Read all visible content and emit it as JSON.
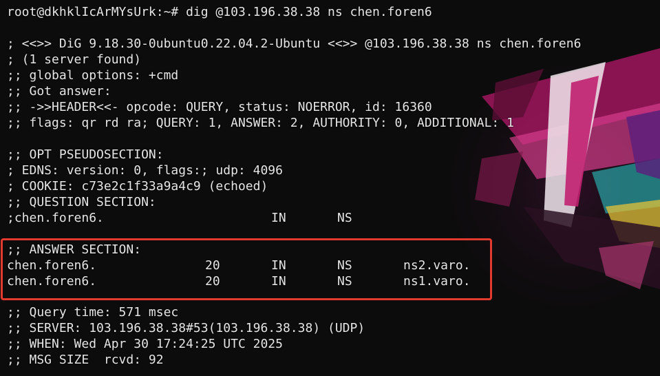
{
  "prompt": "root@dkhklIcArMYsUrk:~# dig @103.196.38.38 ns chen.foren6",
  "header": [
    "; <<>> DiG 9.18.30-0ubuntu0.22.04.2-Ubuntu <<>> @103.196.38.38 ns chen.foren6",
    "; (1 server found)",
    ";; global options: +cmd",
    ";; Got answer:",
    ";; ->>HEADER<<- opcode: QUERY, status: NOERROR, id: 16360",
    ";; flags: qr rd ra; QUERY: 1, ANSWER: 2, AUTHORITY: 0, ADDITIONAL: 1"
  ],
  "opt": [
    ";; OPT PSEUDOSECTION:",
    "; EDNS: version: 0, flags:; udp: 4096",
    "; COOKIE: c73e2c1f33a9a4c9 (echoed)",
    ";; QUESTION SECTION:"
  ],
  "question": {
    "name": ";chen.foren6.",
    "class": "IN",
    "type": "NS"
  },
  "answer": {
    "title": ";; ANSWER SECTION:",
    "records": [
      {
        "name": "chen.foren6.",
        "ttl": "20",
        "class": "IN",
        "type": "NS",
        "data": "ns2.varo."
      },
      {
        "name": "chen.foren6.",
        "ttl": "20",
        "class": "IN",
        "type": "NS",
        "data": "ns1.varo."
      }
    ]
  },
  "footer": [
    ";; Query time: 571 msec",
    ";; SERVER: 103.196.38.38#53(103.196.38.38) (UDP)",
    ";; WHEN: Wed Apr 30 17:24:25 UTC 2025",
    ";; MSG SIZE  rcvd: 92"
  ]
}
